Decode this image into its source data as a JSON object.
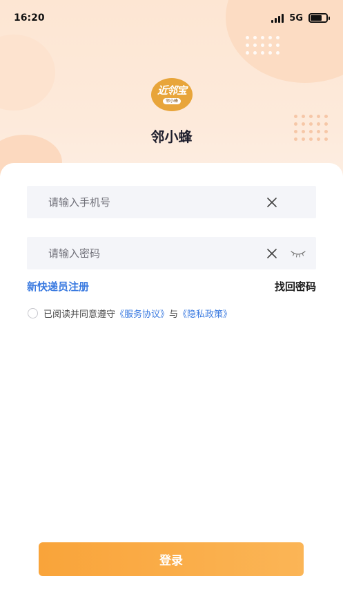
{
  "status_bar": {
    "time": "16:20",
    "network": "5G"
  },
  "app": {
    "logo_text": "近邻宝",
    "logo_sub": "邻小蜂",
    "name": "邻小蜂"
  },
  "form": {
    "phone_placeholder": "请输入手机号",
    "phone_value": "",
    "password_placeholder": "请输入密码",
    "password_value": ""
  },
  "links": {
    "register": "新快递员注册",
    "forgot_password": "找回密码"
  },
  "agreement": {
    "checked": false,
    "prefix": "已阅读并同意遵守",
    "service_link": "《服务协议》",
    "conjunction": "与",
    "privacy_link": "《隐私政策》"
  },
  "login_button": "登录",
  "icons": [
    "signal-icon",
    "battery-icon",
    "clear-icon",
    "eye-closed-icon",
    "radio-icon"
  ],
  "colors": {
    "accent": "#F9A43A",
    "link": "#3A7AE0",
    "header_bg": "#FDE6D3",
    "input_bg": "#F4F5F9"
  }
}
